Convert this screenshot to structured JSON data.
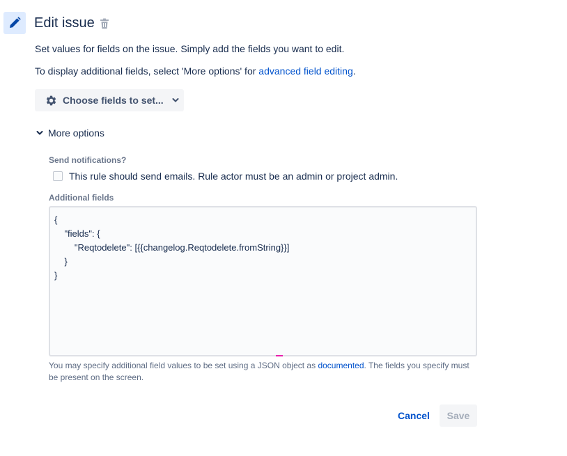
{
  "header": {
    "title": "Edit issue",
    "icon": "pencil-icon",
    "delete_icon": "trash-icon"
  },
  "intro": {
    "line1": "Set values for fields on the issue. Simply add the fields you want to edit.",
    "line2_prefix": "To display additional fields, select 'More options' for ",
    "line2_link": "advanced field editing",
    "line2_suffix": "."
  },
  "choose_fields": {
    "label": "Choose fields to set...",
    "icon": "gear-icon"
  },
  "more_options": {
    "label": "More options",
    "expanded": true
  },
  "notifications": {
    "label": "Send notifications?",
    "checkbox_label": "This rule should send emails. Rule actor must be an admin or project admin.",
    "checked": false
  },
  "additional_fields": {
    "label": "Additional fields",
    "value": "{\n    \"fields\": {\n        \"Reqtodelete\": [{{changelog.Reqtodelete.fromString}}]\n    }\n}",
    "help_prefix": "You may specify additional field values to be set using a JSON object as ",
    "help_link": "documented",
    "help_suffix": ". The fields you specify must be present on the screen."
  },
  "actions": {
    "cancel": "Cancel",
    "save": "Save"
  },
  "colors": {
    "accent": "#0052cc",
    "icon_bg": "#deebff",
    "text": "#172b4d"
  }
}
